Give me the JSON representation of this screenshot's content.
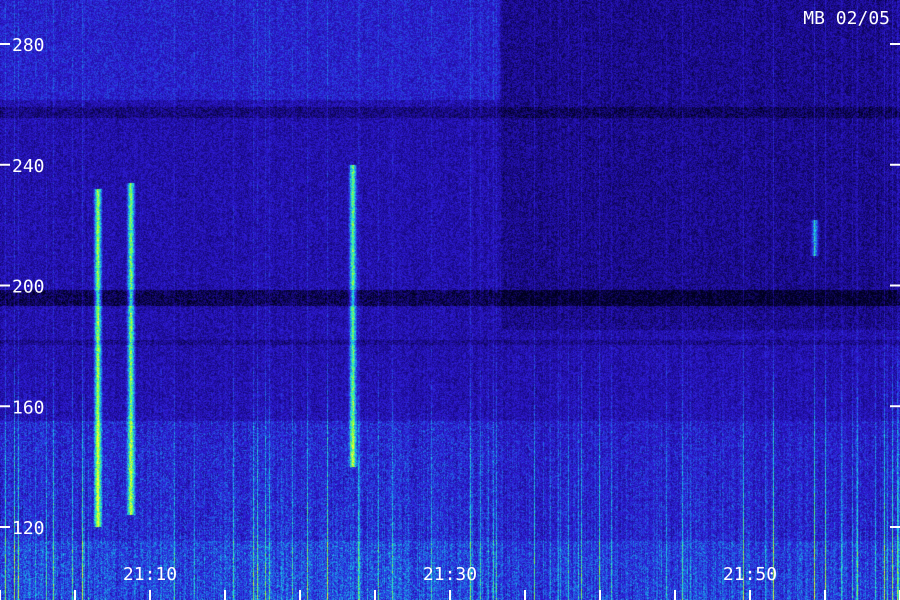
{
  "chart_data": {
    "type": "heatmap",
    "title": "MB 02/05",
    "xlabel": "",
    "ylabel": "",
    "y_ticks": [
      120,
      160,
      200,
      240,
      280
    ],
    "ylim": [
      110,
      292
    ],
    "x_ticks": [
      "21:10",
      "21:30",
      "21:50"
    ],
    "xlim_minutes": [
      0,
      60
    ],
    "x_tick_minutes": [
      10,
      30,
      50
    ],
    "colormap": [
      "#000033",
      "#1a0a8c",
      "#2f1cd8",
      "#1e7be6",
      "#1fe0e0",
      "#7fff40",
      "#ffff30"
    ],
    "description_bands": {
      "background": "#221488",
      "horizontal_dark_band_freq": 196,
      "bright_bursts": [
        {
          "time_min": 6.5,
          "freq_low": 120,
          "freq_high": 232,
          "intensity": 1.0
        },
        {
          "time_min": 8.7,
          "freq_low": 124,
          "freq_high": 234,
          "intensity": 0.95
        },
        {
          "time_min": 23.5,
          "freq_low": 140,
          "freq_high": 240,
          "intensity": 0.85
        },
        {
          "time_min": 54.3,
          "freq_low": 210,
          "freq_high": 222,
          "intensity": 0.6
        }
      ]
    }
  }
}
